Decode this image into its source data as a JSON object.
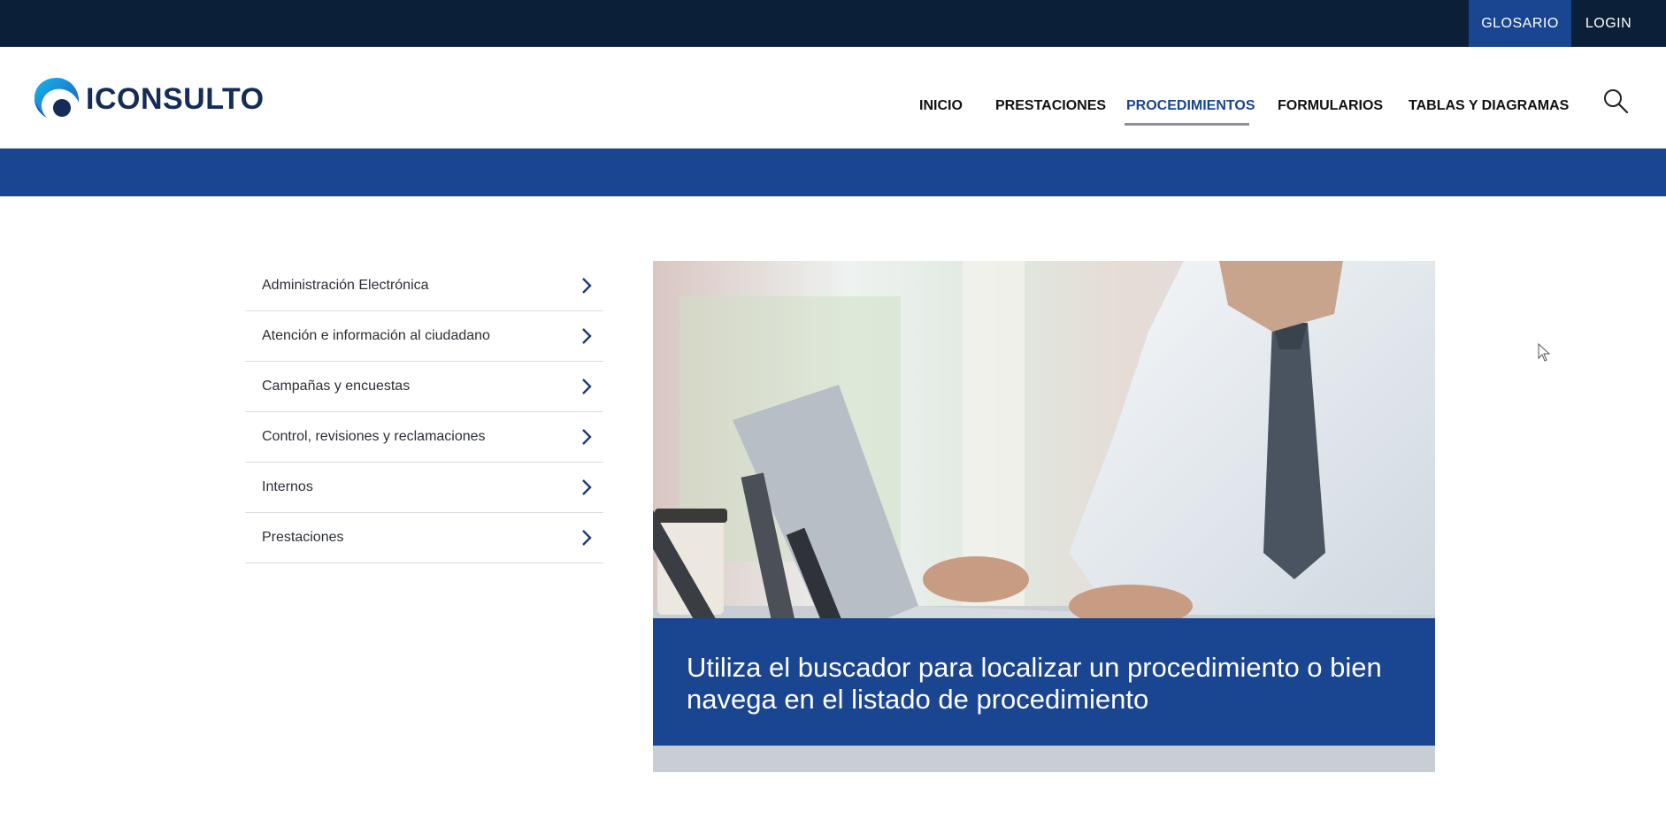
{
  "topbar": {
    "glosario_label": "GLOSARIO",
    "login_label": "LOGIN"
  },
  "header": {
    "logo_text": "ICONSULTO",
    "nav": [
      {
        "label": "INICIO"
      },
      {
        "label": "PRESTACIONES"
      },
      {
        "label": "PROCEDIMIENTOS",
        "active": true
      },
      {
        "label": "FORMULARIOS"
      },
      {
        "label": "TABLAS Y DIAGRAMAS"
      }
    ],
    "search_icon": "search-icon"
  },
  "categories": [
    {
      "label": "Administración Electrónica"
    },
    {
      "label": "Atención e información al ciudadano"
    },
    {
      "label": "Campañas y encuestas"
    },
    {
      "label": "Control, revisiones y reclamaciones"
    },
    {
      "label": "Internos"
    },
    {
      "label": "Prestaciones"
    }
  ],
  "hero": {
    "caption": "Utiliza el buscador para localizar un procedimiento o bien navega en el listado de procedimiento"
  },
  "colors": {
    "topbar": "#0b2038",
    "accent_blue": "#1a4590",
    "brand_navy": "#142c57"
  }
}
